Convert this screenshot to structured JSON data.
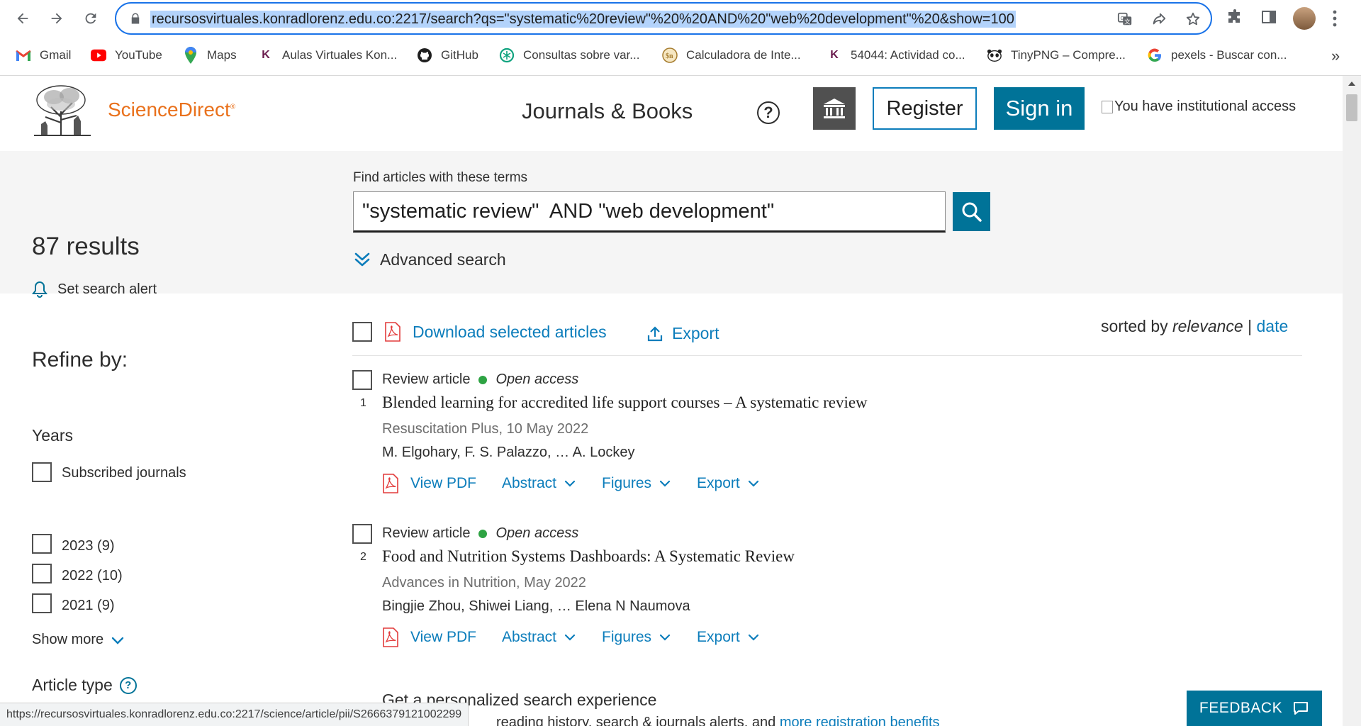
{
  "browser": {
    "url": "recursosvirtuales.konradlorenz.edu.co:2217/search?qs=\"systematic%20review\"%20%20AND%20\"web%20development\"%20&show=100",
    "status_url": "https://recursosvirtuales.konradlorenz.edu.co:2217/science/article/pii/S2666379121002299",
    "bookmarks": [
      {
        "label": "Gmail",
        "icon": "gmail-icon"
      },
      {
        "label": "YouTube",
        "icon": "youtube-icon"
      },
      {
        "label": "Maps",
        "icon": "maps-icon"
      },
      {
        "label": "Aulas Virtuales Kon...",
        "icon": "konrad-k-icon"
      },
      {
        "label": "GitHub",
        "icon": "github-icon"
      },
      {
        "label": "Consultas sobre var...",
        "icon": "chatgpt-icon"
      },
      {
        "label": "Calculadora de Inte...",
        "icon": "calculator-site-icon"
      },
      {
        "label": "54044: Actividad co...",
        "icon": "konrad-k-icon"
      },
      {
        "label": "TinyPNG – Compre...",
        "icon": "tinypng-panda-icon"
      },
      {
        "label": "pexels - Buscar con...",
        "icon": "google-icon"
      }
    ],
    "overflow": "»"
  },
  "header": {
    "logo_text": "ScienceDirect",
    "logo_mark": "®",
    "journals_books": "Journals & Books",
    "help": "?",
    "register": "Register",
    "sign_in": "Sign in",
    "institutional_access": "You have institutional access"
  },
  "search": {
    "label": "Find articles with these terms",
    "query": "\"systematic review\"  AND \"web development\"",
    "advanced": "Advanced search"
  },
  "sidebar": {
    "result_count": "87 results",
    "set_alert": "Set search alert",
    "refine_title": "Refine by:",
    "subscribed": "Subscribed journals",
    "years_title": "Years",
    "years": [
      "2023 (9)",
      "2022 (10)",
      "2021 (9)"
    ],
    "show_more": "Show more",
    "article_type": "Article type",
    "article_type_help": "?"
  },
  "toolbar": {
    "download_selected": "Download selected articles",
    "export": "Export",
    "sorted_by": "sorted by",
    "relevance": "relevance",
    "separator": "|",
    "date": "date"
  },
  "results": [
    {
      "type": "Review article",
      "access": "Open access",
      "number": "1",
      "title": "Blended learning for accredited life support courses – A systematic review",
      "source": "Resuscitation Plus, 10 May 2022",
      "authors": "M. Elgohary, F. S. Palazzo, … A. Lockey",
      "actions": {
        "pdf": "View PDF",
        "abstract": "Abstract",
        "figures": "Figures",
        "export": "Export"
      }
    },
    {
      "type": "Review article",
      "access": "Open access",
      "number": "2",
      "title": "Food and Nutrition Systems Dashboards: A Systematic Review",
      "source": "Advances in Nutrition, May 2022",
      "authors": "Bingjie Zhou, Shiwei Liang, … Elena N Naumova",
      "actions": {
        "pdf": "View PDF",
        "abstract": "Abstract",
        "figures": "Figures",
        "export": "Export"
      }
    }
  ],
  "promo": {
    "title": "Get a personalized search experience",
    "sub_text": "reading history, search & journals alerts, and ",
    "sub_link": "more registration benefits"
  },
  "feedback": "FEEDBACK",
  "colors": {
    "accent": "#007398",
    "link": "#0c7dbb",
    "brand_orange": "#e9711c",
    "open_access": "#2ea343",
    "omnibox_focus": "#1a73e8"
  }
}
